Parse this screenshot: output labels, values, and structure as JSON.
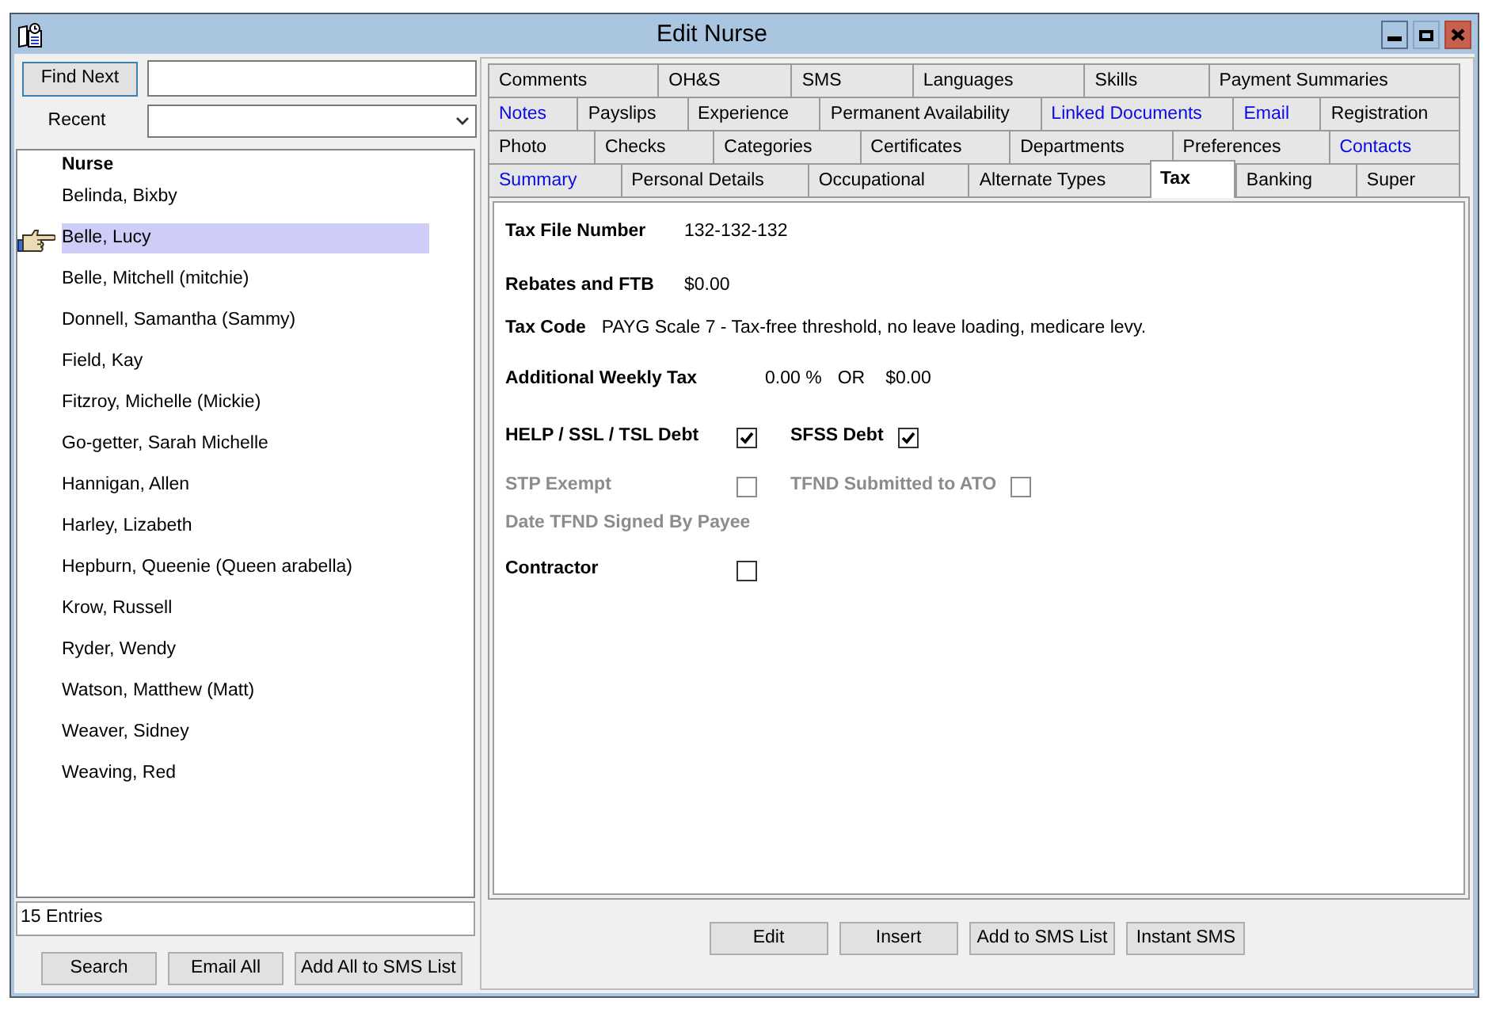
{
  "window": {
    "title": "Edit Nurse"
  },
  "finder": {
    "button": "Find Next",
    "recent_label": "Recent"
  },
  "nurse_list": {
    "header": "Nurse",
    "items": [
      {
        "name": "Belinda, Bixby",
        "selected": false
      },
      {
        "name": "Belle, Lucy",
        "selected": true
      },
      {
        "name": "Belle, Mitchell (mitchie)",
        "selected": false
      },
      {
        "name": "Donnell, Samantha (Sammy)",
        "selected": false
      },
      {
        "name": "Field, Kay",
        "selected": false
      },
      {
        "name": "Fitzroy, Michelle (Mickie)",
        "selected": false
      },
      {
        "name": "Go-getter, Sarah Michelle",
        "selected": false
      },
      {
        "name": "Hannigan, Allen",
        "selected": false
      },
      {
        "name": "Harley, Lizabeth",
        "selected": false
      },
      {
        "name": "Hepburn, Queenie (Queen arabella)",
        "selected": false
      },
      {
        "name": "Krow, Russell",
        "selected": false
      },
      {
        "name": "Ryder, Wendy",
        "selected": false
      },
      {
        "name": "Watson, Matthew (Matt)",
        "selected": false
      },
      {
        "name": "Weaver, Sidney",
        "selected": false
      },
      {
        "name": "Weaving, Red",
        "selected": false
      }
    ]
  },
  "entries": "15 Entries",
  "list_buttons": [
    "Search",
    "Email All",
    "Add All to SMS List"
  ],
  "tab_rows": [
    {
      "tabs": [
        {
          "label": "Comments",
          "selected": false,
          "highlighted": false
        },
        {
          "label": "OH&S",
          "selected": false,
          "highlighted": false
        },
        {
          "label": "SMS",
          "selected": false,
          "highlighted": false
        },
        {
          "label": "Languages",
          "selected": false,
          "highlighted": false
        },
        {
          "label": "Skills",
          "selected": false,
          "highlighted": false
        },
        {
          "label": "Payment Summaries",
          "selected": false,
          "highlighted": false
        }
      ]
    },
    {
      "tabs": [
        {
          "label": "Notes",
          "selected": false,
          "highlighted": true
        },
        {
          "label": "Payslips",
          "selected": false,
          "highlighted": false
        },
        {
          "label": "Experience",
          "selected": false,
          "highlighted": false
        },
        {
          "label": "Permanent Availability",
          "selected": false,
          "highlighted": false
        },
        {
          "label": "Linked Documents",
          "selected": false,
          "highlighted": true
        },
        {
          "label": "Email",
          "selected": false,
          "highlighted": true
        },
        {
          "label": "Registration",
          "selected": false,
          "highlighted": false
        }
      ]
    },
    {
      "tabs": [
        {
          "label": "Photo",
          "selected": false,
          "highlighted": false
        },
        {
          "label": "Checks",
          "selected": false,
          "highlighted": false
        },
        {
          "label": "Categories",
          "selected": false,
          "highlighted": false
        },
        {
          "label": "Certificates",
          "selected": false,
          "highlighted": false
        },
        {
          "label": "Departments",
          "selected": false,
          "highlighted": false
        },
        {
          "label": "Preferences",
          "selected": false,
          "highlighted": false
        },
        {
          "label": "Contacts",
          "selected": false,
          "highlighted": true
        }
      ]
    },
    {
      "tabs": [
        {
          "label": "Summary",
          "selected": false,
          "highlighted": true
        },
        {
          "label": "Personal Details",
          "selected": false,
          "highlighted": false
        },
        {
          "label": "Occupational",
          "selected": false,
          "highlighted": false
        },
        {
          "label": "Alternate Types",
          "selected": false,
          "highlighted": false
        },
        {
          "label": "Tax",
          "selected": true,
          "highlighted": false
        },
        {
          "label": "Banking",
          "selected": false,
          "highlighted": false
        },
        {
          "label": "Super",
          "selected": false,
          "highlighted": false
        }
      ]
    }
  ],
  "tax_fields": [
    {
      "kind": "field",
      "label": "Tax File Number",
      "value": "132-132-132"
    },
    {
      "kind": "field",
      "label": "Rebates and FTB",
      "value": "$0.00"
    },
    {
      "kind": "inline",
      "label": "Tax Code",
      "value": "PAYG Scale 7 - Tax-free threshold, no leave loading, medicare levy."
    },
    {
      "kind": "amounts",
      "label": "Additional Weekly Tax",
      "percent": "0.00 %",
      "separator": "OR",
      "amount": "$0.00"
    },
    {
      "kind": "checks",
      "items": [
        {
          "label": "HELP / SSL / TSL Debt",
          "checked": true,
          "disabled": false
        },
        {
          "label": "SFSS Debt",
          "checked": true,
          "disabled": false
        }
      ]
    },
    {
      "kind": "checks",
      "items": [
        {
          "label": "STP Exempt",
          "checked": false,
          "disabled": true
        },
        {
          "label": "TFND Submitted to ATO",
          "checked": false,
          "disabled": true
        }
      ]
    },
    {
      "kind": "label",
      "label": "Date TFND Signed By Payee",
      "disabled": true
    },
    {
      "kind": "checks",
      "items": [
        {
          "label": "Contractor",
          "checked": false,
          "disabled": false
        }
      ]
    }
  ],
  "page_buttons": [
    "Edit",
    "Insert",
    "Add to SMS List",
    "Instant SMS"
  ]
}
